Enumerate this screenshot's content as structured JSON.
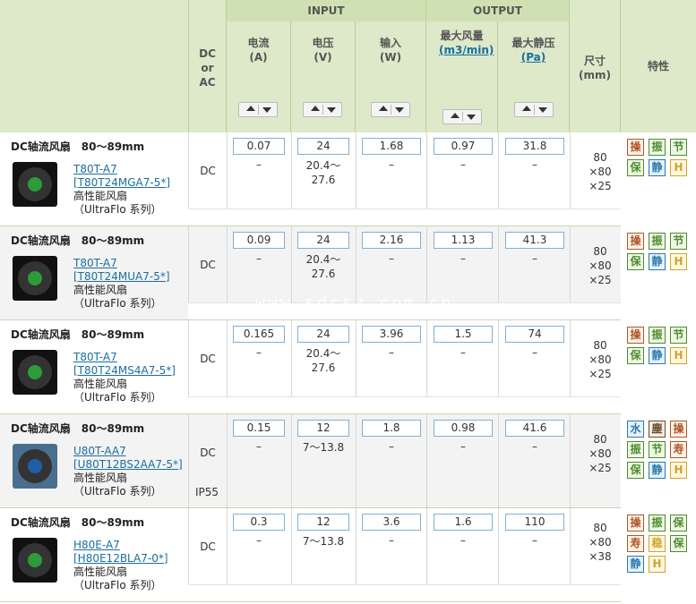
{
  "header": {
    "col_dcac": "DC\nor\nAC",
    "group_input": "INPUT",
    "group_output": "OUTPUT",
    "col_current": {
      "label": "电流",
      "unit": "(A)"
    },
    "col_voltage": {
      "label": "电压",
      "unit": "(V)"
    },
    "col_power": {
      "label": "输入",
      "unit": "(W)"
    },
    "col_airflow": {
      "label": "最大风量",
      "unit": "(m3/min)"
    },
    "col_pressure": {
      "label": "最大静压",
      "unit": "(Pa)"
    },
    "col_size": {
      "label": "尺寸",
      "unit": "(mm)"
    },
    "col_feature": "特性"
  },
  "rows": [
    {
      "title": "DC轴流风扇　80～89mm",
      "model_line1": "T80T-A7",
      "model_line2": "[T80T24MGA7-5*]",
      "desc_line1": "高性能风扇",
      "desc_line2": "（UltraFlo 系列）",
      "dcac": "DC",
      "current": "0.07",
      "current_sub": "–",
      "voltage": "24",
      "voltage_sub": "20.4～\n27.6",
      "power": "1.68",
      "power_sub": "–",
      "airflow": "0.97",
      "airflow_sub": "–",
      "pressure": "31.8",
      "pressure_sub": "–",
      "size": "80\n×80\n×25",
      "features": [
        [
          "操",
          "振",
          "节"
        ],
        [
          "保",
          "静",
          "H"
        ]
      ]
    },
    {
      "title": "DC轴流风扇　80～89mm",
      "model_line1": "T80T-A7",
      "model_line2": "[T80T24MUA7-5*]",
      "desc_line1": "高性能风扇",
      "desc_line2": "（UltraFlo 系列）",
      "dcac": "DC",
      "current": "0.09",
      "current_sub": "–",
      "voltage": "24",
      "voltage_sub": "20.4～\n27.6",
      "power": "2.16",
      "power_sub": "–",
      "airflow": "1.13",
      "airflow_sub": "–",
      "pressure": "41.3",
      "pressure_sub": "–",
      "size": "80\n×80\n×25",
      "features": [
        [
          "操",
          "振",
          "节"
        ],
        [
          "保",
          "静",
          "H"
        ]
      ]
    },
    {
      "title": "DC轴流风扇　80～89mm",
      "model_line1": "T80T-A7",
      "model_line2": "[T80T24MS4A7-5*]",
      "desc_line1": "高性能风扇",
      "desc_line2": "（UltraFlo 系列）",
      "dcac": "DC",
      "current": "0.165",
      "current_sub": "–",
      "voltage": "24",
      "voltage_sub": "20.4～\n27.6",
      "power": "3.96",
      "power_sub": "–",
      "airflow": "1.5",
      "airflow_sub": "–",
      "pressure": "74",
      "pressure_sub": "–",
      "size": "80\n×80\n×25",
      "features": [
        [
          "操",
          "振",
          "节"
        ],
        [
          "保",
          "静",
          "H"
        ]
      ]
    },
    {
      "title": "DC轴流风扇　80～89mm",
      "model_line1": "U80T-AA7",
      "model_line2": "[U80T12BS2AA7-5*]",
      "desc_line1": "高性能风扇",
      "desc_line2": "（UltraFlo 系列）",
      "dcac": "DC",
      "current": "0.15",
      "current_sub": "–",
      "voltage": "12",
      "voltage_sub": "7～13.8",
      "power": "1.8",
      "power_sub": "–",
      "airflow": "0.98",
      "airflow_sub": "–",
      "pressure": "41.6",
      "pressure_sub": "–",
      "size": "80\n×80\n×25",
      "ip": "IP55",
      "features": [
        [
          "水",
          "塵",
          "操"
        ],
        [
          "振",
          "节",
          "寿"
        ],
        [
          "保",
          "静",
          "H"
        ]
      ]
    },
    {
      "title": "DC轴流风扇　80～89mm",
      "model_line1": "H80E-A7",
      "model_line2": "[H80E12BLA7-0*]",
      "desc_line1": "高性能风扇",
      "desc_line2": "（UltraFlo 系列）",
      "dcac": "DC",
      "current": "0.3",
      "current_sub": "–",
      "voltage": "12",
      "voltage_sub": "7～13.8",
      "power": "3.6",
      "power_sub": "–",
      "airflow": "1.6",
      "airflow_sub": "–",
      "pressure": "110",
      "pressure_sub": "–",
      "size": "80\n×80\n×38",
      "features": [
        [
          "操",
          "振",
          "保"
        ],
        [
          "寿",
          "稳",
          "保"
        ],
        [
          "静",
          "H"
        ]
      ]
    }
  ],
  "watermark": "www.sdcsz.com.cn",
  "colors": {
    "header_bg": "#dde9c9",
    "group_bg": "#cfe1b3",
    "link": "#1a6ea0",
    "input_border": "#7fb0d6"
  }
}
